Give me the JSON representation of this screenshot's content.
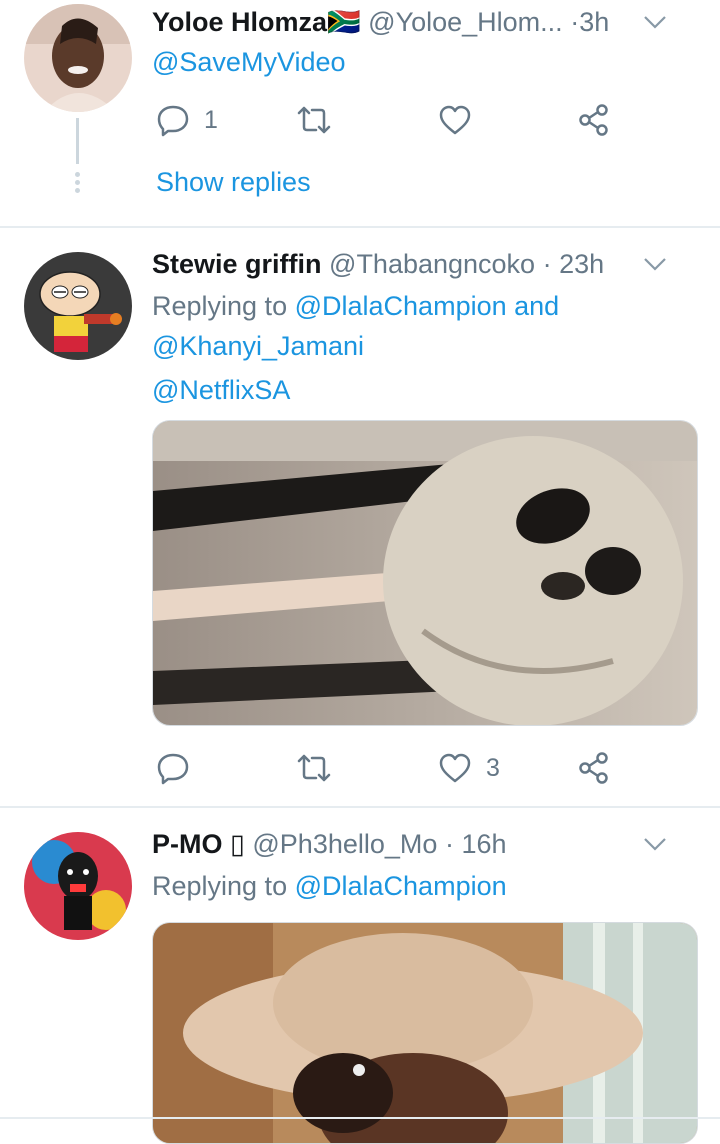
{
  "tweets": [
    {
      "name": "Yoloe Hlomza",
      "flag_emoji": "🇿🇦",
      "handle": "@Yoloe_Hlom...",
      "dot": "·",
      "time": "3h",
      "text": "@SaveMyVideo",
      "reply_count": "1",
      "like_count": "",
      "show_replies": "Show replies"
    },
    {
      "name": "Stewie griffin",
      "handle": "@Thabangncoko",
      "dot": "·",
      "time": "23h",
      "replying_prefix": "Replying to",
      "replying_user1": "@DlalaChampion",
      "replying_and": "and",
      "replying_user2": "@Khanyi_Jamani",
      "text": "@NetflixSA",
      "reply_count": "",
      "like_count": "3"
    },
    {
      "name": "P-MO",
      "name_emoji": "▯",
      "handle": "@Ph3hello_Mo",
      "dot": "·",
      "time": "16h",
      "replying_prefix": "Replying to",
      "replying_user1": "@DlalaChampion"
    }
  ],
  "colors": {
    "link": "#1b95e0",
    "secondary": "#657786",
    "divider": "#e6ecf0"
  },
  "icons": [
    "reply-icon",
    "retweet-icon",
    "like-icon",
    "share-icon",
    "chevron-down-icon"
  ]
}
